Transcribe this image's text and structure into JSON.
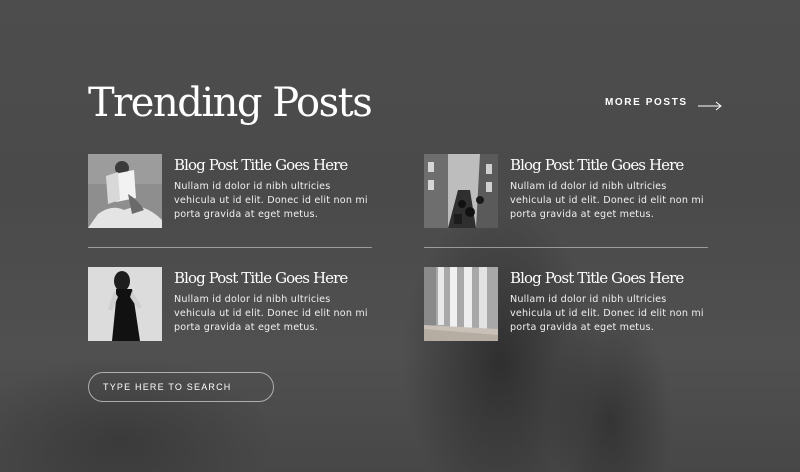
{
  "section": {
    "title": "Trending Posts",
    "more_posts_label": "MORE POSTS",
    "more_posts_icon": "arrow-right-icon"
  },
  "posts": [
    {
      "title": "Blog Post Title Goes Here",
      "excerpt": "Nullam id dolor id nibh ultricies vehicula ut id elit. Donec id elit non mi porta gravida at eget metus.",
      "thumbnail": "woman-reading-magazine-photo"
    },
    {
      "title": "Blog Post Title Goes Here",
      "excerpt": "Nullam id dolor id nibh ultricies vehicula ut id elit. Donec id elit non mi porta gravida at eget metus.",
      "thumbnail": "city-street-scooters-photo"
    },
    {
      "title": "Blog Post Title Goes Here",
      "excerpt": "Nullam id dolor id nibh ultricies vehicula ut id elit. Donec id elit non mi porta gravida at eget metus.",
      "thumbnail": "woman-black-dress-photo"
    },
    {
      "title": "Blog Post Title Goes Here",
      "excerpt": "Nullam id dolor id nibh ultricies vehicula ut id elit. Donec id elit non mi porta gravida at eget metus.",
      "thumbnail": "light-through-window-photo"
    }
  ],
  "search": {
    "placeholder": "TYPE HERE TO SEARCH",
    "value": ""
  },
  "colors": {
    "background": "#4a4a4a",
    "text": "#ffffff",
    "divider": "#9a9a9a"
  }
}
